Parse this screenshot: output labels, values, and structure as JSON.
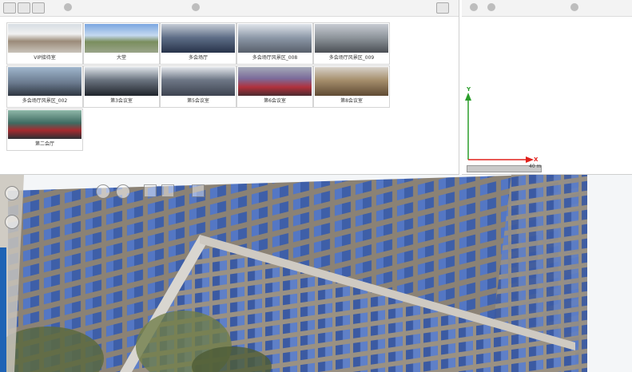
{
  "thumbnails": [
    {
      "caption": "VIP接待室",
      "scene": "t1"
    },
    {
      "caption": "大堂",
      "scene": "t2"
    },
    {
      "caption": "多会场厅",
      "scene": "t3"
    },
    {
      "caption": "多会场厅风景区_008",
      "scene": "t4"
    },
    {
      "caption": "多会场厅风景区_009",
      "scene": "t5"
    },
    {
      "caption": "多会场厅风景区_002",
      "scene": "t6"
    },
    {
      "caption": "第3会议室",
      "scene": "t7"
    },
    {
      "caption": "第5会议室",
      "scene": "t8"
    },
    {
      "caption": "第6会议室",
      "scene": "t9"
    },
    {
      "caption": "第8会议室",
      "scene": "t10"
    },
    {
      "caption": "第二会厅",
      "scene": "t11"
    }
  ],
  "axes": {
    "x_label": "X",
    "y_label": "Y",
    "x_color": "#e0201b",
    "y_color": "#2a9d2a"
  },
  "scale": {
    "label": "40 m"
  },
  "colors": {
    "accent_strip": "#1e63b5",
    "facade_glass": "#3e5fa8",
    "facade_stone": "#8b8275"
  }
}
